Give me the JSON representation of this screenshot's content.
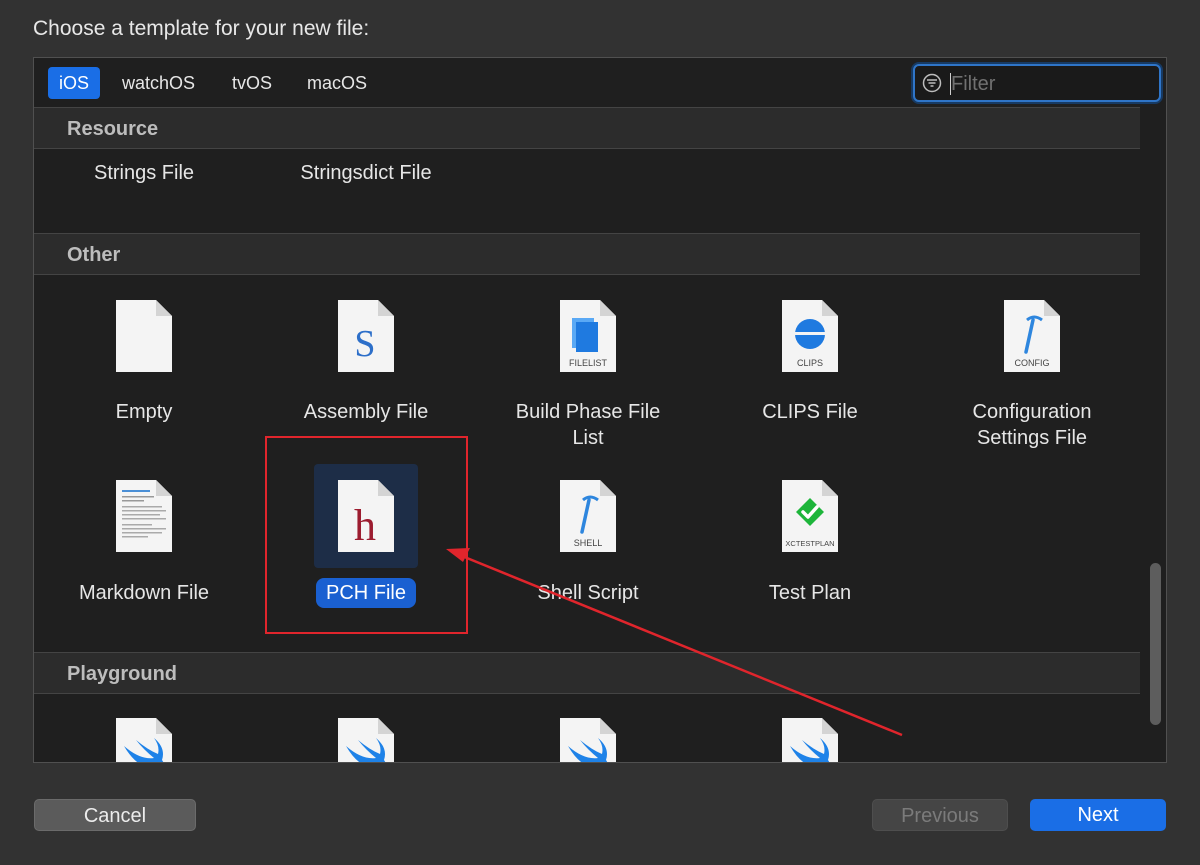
{
  "dialog": {
    "heading": "Choose a template for your new file:"
  },
  "tabs": [
    {
      "label": "iOS",
      "selected": true
    },
    {
      "label": "watchOS",
      "selected": false
    },
    {
      "label": "tvOS",
      "selected": false
    },
    {
      "label": "macOS",
      "selected": false
    }
  ],
  "filter": {
    "placeholder": "Filter",
    "value": ""
  },
  "sections": {
    "resource": {
      "title": "Resource",
      "items": [
        {
          "label": "Strings File"
        },
        {
          "label": "Stringsdict File"
        }
      ]
    },
    "other": {
      "title": "Other",
      "items": [
        {
          "label": "Empty",
          "icon": "blank-document-icon"
        },
        {
          "label": "Assembly File",
          "icon": "assembly-document-icon",
          "glyph": "S"
        },
        {
          "label_line1": "Build Phase File",
          "label_line2": "List",
          "icon": "filelist-document-icon",
          "badge": "FILELIST"
        },
        {
          "label": "CLIPS File",
          "icon": "clips-document-icon",
          "badge": "CLIPS"
        },
        {
          "label_line1": "Configuration",
          "label_line2": "Settings File",
          "icon": "config-document-icon",
          "badge": "CONFIG"
        },
        {
          "label": "Markdown File",
          "icon": "markdown-document-icon"
        },
        {
          "label": "PCH File",
          "icon": "pch-document-icon",
          "glyph": "h",
          "selected": true
        },
        {
          "label": "Shell Script",
          "icon": "shell-document-icon",
          "badge": "SHELL"
        },
        {
          "label": "Test Plan",
          "icon": "testplan-document-icon",
          "badge": "XCTESTPLAN"
        }
      ]
    },
    "playground": {
      "title": "Playground"
    }
  },
  "buttons": {
    "cancel": "Cancel",
    "previous": "Previous",
    "next": "Next"
  },
  "colors": {
    "accent": "#1a6ee6",
    "selection": "#1a60d1",
    "annotation": "#e0252c",
    "swift": "#1e82e8",
    "clips": "#1f7ae0",
    "test_green": "#1db53a",
    "pch_glyph": "#9c1c2f"
  }
}
